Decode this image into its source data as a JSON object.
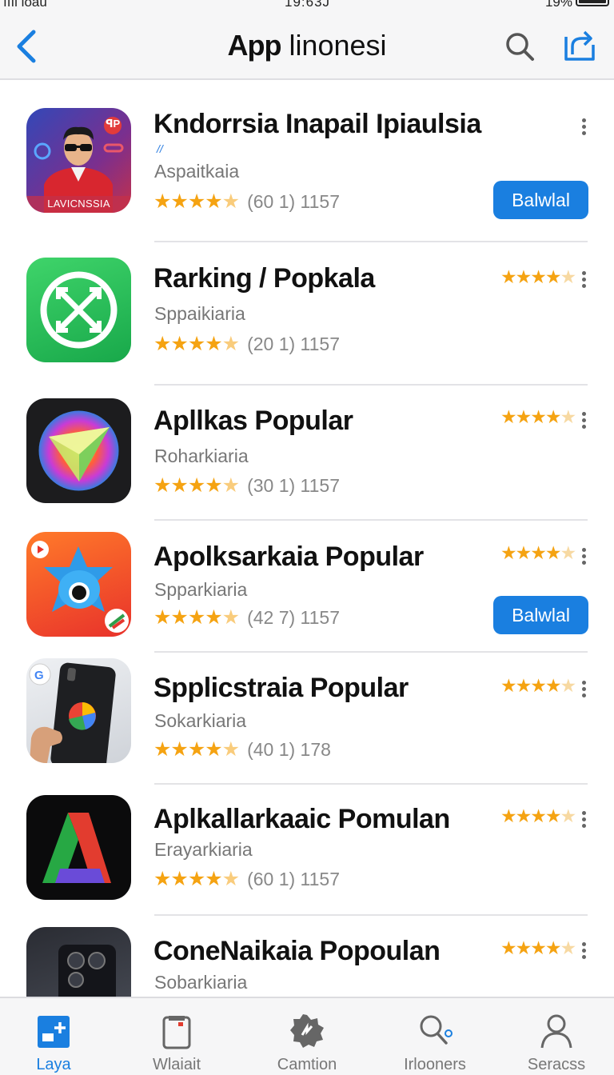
{
  "status_bar": {
    "carrier": "ıııl ioau",
    "time": "19:63J",
    "battery": "19%"
  },
  "header": {
    "title_bold": "App",
    "title_rest": " linonesi"
  },
  "apps": [
    {
      "name": "Kndorrsia Inapail Ipiaulsia",
      "category": "Aspaitkaia",
      "rating_count": "(60 1)  1157",
      "icon_caption": "LAVICNSSIA",
      "icon_badge": "ꟼP",
      "button": "Balwlal",
      "mini_rating": ""
    },
    {
      "name": "Rarking / Popkala",
      "category": "Sppaikiaria",
      "rating_count": "(20 1) 1157",
      "mini_rating": "★★★★"
    },
    {
      "name": "Apllkas Popular",
      "category": "Roharkiaria",
      "rating_count": "(30 1)  1157",
      "mini_rating": "★★★★"
    },
    {
      "name": "Apolksarkaia Popular",
      "category": "Spparkiaria",
      "rating_count": "(42 7)  1157",
      "button": "Balwlal",
      "mini_rating": "★★★★"
    },
    {
      "name": "Spplicstraia Popular",
      "category": "Sokarkiaria",
      "rating_count": "(40 1)  178",
      "mini_rating": "★★★★"
    },
    {
      "name": "Aplkallarkaaic Pomulan",
      "category": "Erayarkiaria",
      "rating_count": "(60 1)  1157",
      "mini_rating": "★★★★"
    },
    {
      "name": "ConeNaikaia Popoulan",
      "category": "Sobarkiaria",
      "rating_count": "",
      "mini_rating": "★★★★"
    }
  ],
  "tabs": [
    {
      "label": "Laya",
      "icon": "today-icon",
      "active": true
    },
    {
      "label": "Wlaiait",
      "icon": "games-icon",
      "active": false
    },
    {
      "label": "Camtion",
      "icon": "apps-icon",
      "active": false
    },
    {
      "label": "Irlooners",
      "icon": "search-icon",
      "active": false
    },
    {
      "label": "Seracss",
      "icon": "account-icon",
      "active": false
    }
  ],
  "colors": {
    "accent": "#1a7fe0",
    "star": "#f5a312",
    "background": "#ffffff",
    "bar": "#f6f6f7"
  }
}
